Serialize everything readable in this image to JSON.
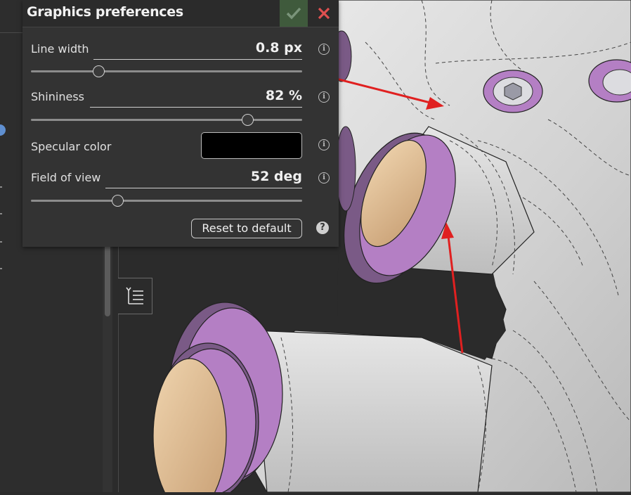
{
  "dialog": {
    "title": "Graphics preferences",
    "rows": {
      "line_width": {
        "label": "Line width",
        "value": "0.8 px",
        "slider_fraction": 0.25
      },
      "shininess": {
        "label": "Shininess",
        "value": "82 %",
        "slider_fraction": 0.8
      },
      "specular": {
        "label": "Specular color",
        "color": "#000000"
      },
      "fov": {
        "label": "Field of view",
        "value": "52 deg",
        "slider_fraction": 0.32
      }
    },
    "reset_label": "Reset to default",
    "info_glyph": "i",
    "help_glyph": "?"
  },
  "colors": {
    "accent_green": "#3f5a3c",
    "close_red": "#e05050",
    "part_purple": "#b47fc4",
    "part_grey": "#d6d6d6",
    "annotation_red": "#e02020"
  },
  "icons": {
    "ok": "check-icon",
    "close": "close-icon",
    "list": "list-tree-icon"
  }
}
